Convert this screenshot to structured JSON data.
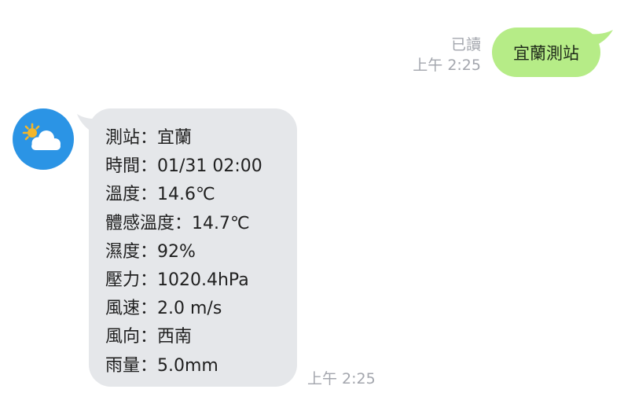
{
  "outgoing": {
    "read_label": "已讀",
    "time": "上午 2:25",
    "text": "宜蘭測站",
    "bubble_color": "#b6ec87"
  },
  "incoming": {
    "avatar_icon": "partly-cloudy-icon",
    "avatar_color": "#2b94e5",
    "bubble_color": "#e5e7ea",
    "time": "上午 2:25",
    "lines": [
      "測站：宜蘭",
      "時間：01/31 02:00",
      "溫度：14.6℃",
      "體感溫度：14.7℃",
      "濕度：92%",
      "壓力：1020.4hPa",
      "風速：2.0 m/s",
      "風向：西南",
      "雨量：5.0mm"
    ]
  }
}
